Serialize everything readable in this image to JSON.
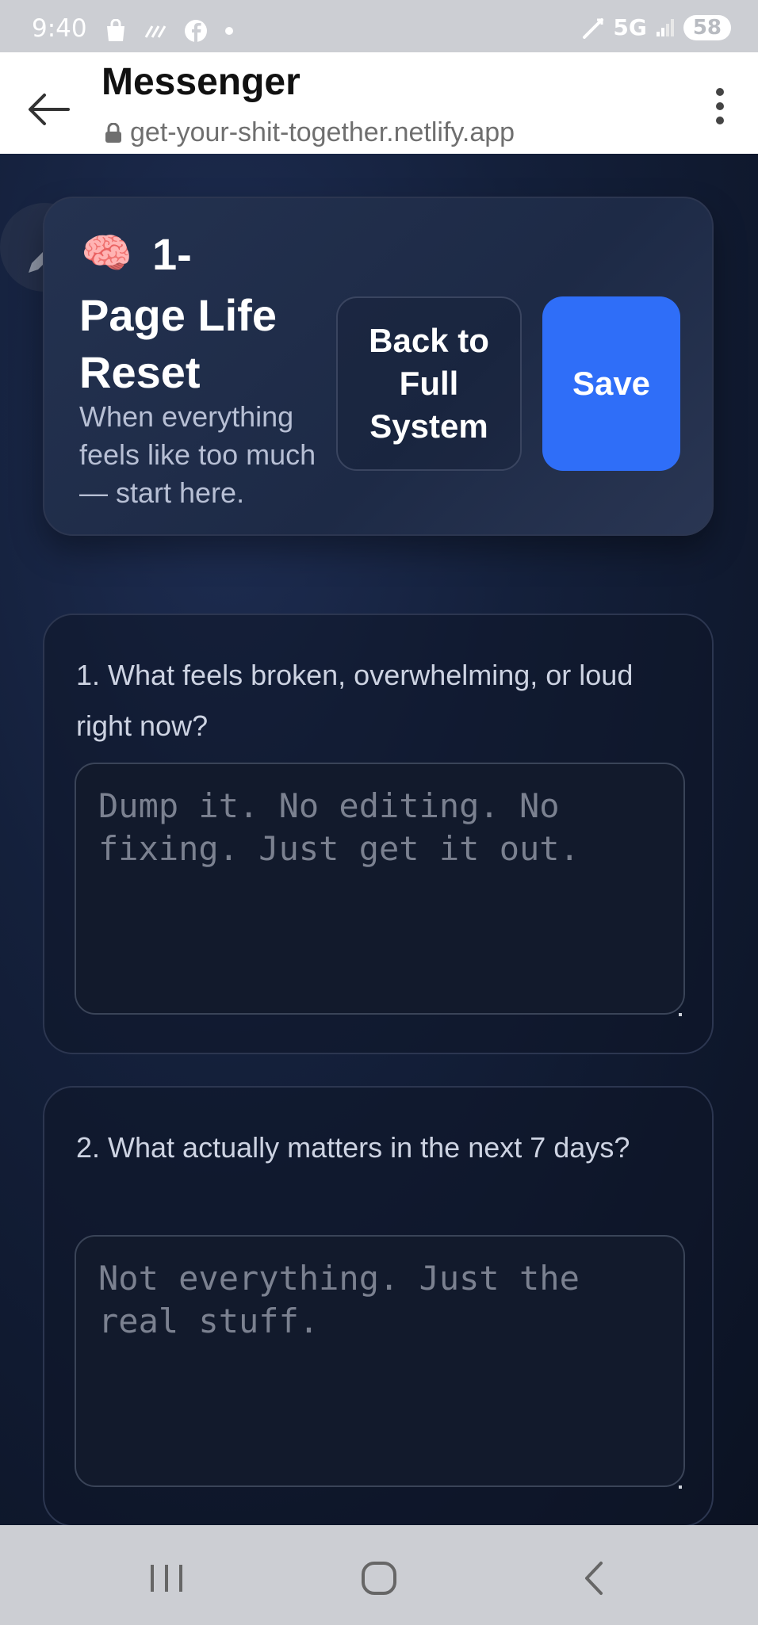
{
  "status_bar": {
    "time": "9:40",
    "network": "5G",
    "battery": "58",
    "left_icons": [
      "shopping-bag-icon",
      "link-icon",
      "facebook-icon",
      "dot-icon"
    ],
    "right_icons": [
      "wifi-call-icon",
      "signal-icon"
    ]
  },
  "browser": {
    "title": "Messenger",
    "url": "get-your-shit-together.netlify.app"
  },
  "header": {
    "emoji": "🧠",
    "title_line1": "1-",
    "title_line2": "Page Life Reset",
    "subtitle": "When everything feels like too much — start here.",
    "back_button": "Back to Full System",
    "save_button": "Save"
  },
  "questions": [
    {
      "label": "1. What feels broken, overwhelming, or loud right now?",
      "placeholder": "Dump it. No editing. No fixing. Just get it out.",
      "value": ""
    },
    {
      "label": "2. What actually matters in the next 7 days?",
      "placeholder": "Not everything. Just the real stuff.",
      "value": ""
    }
  ],
  "colors": {
    "accent": "#2f6ef8",
    "page_bg": "#14203b",
    "system_bar": "#ccced3"
  }
}
